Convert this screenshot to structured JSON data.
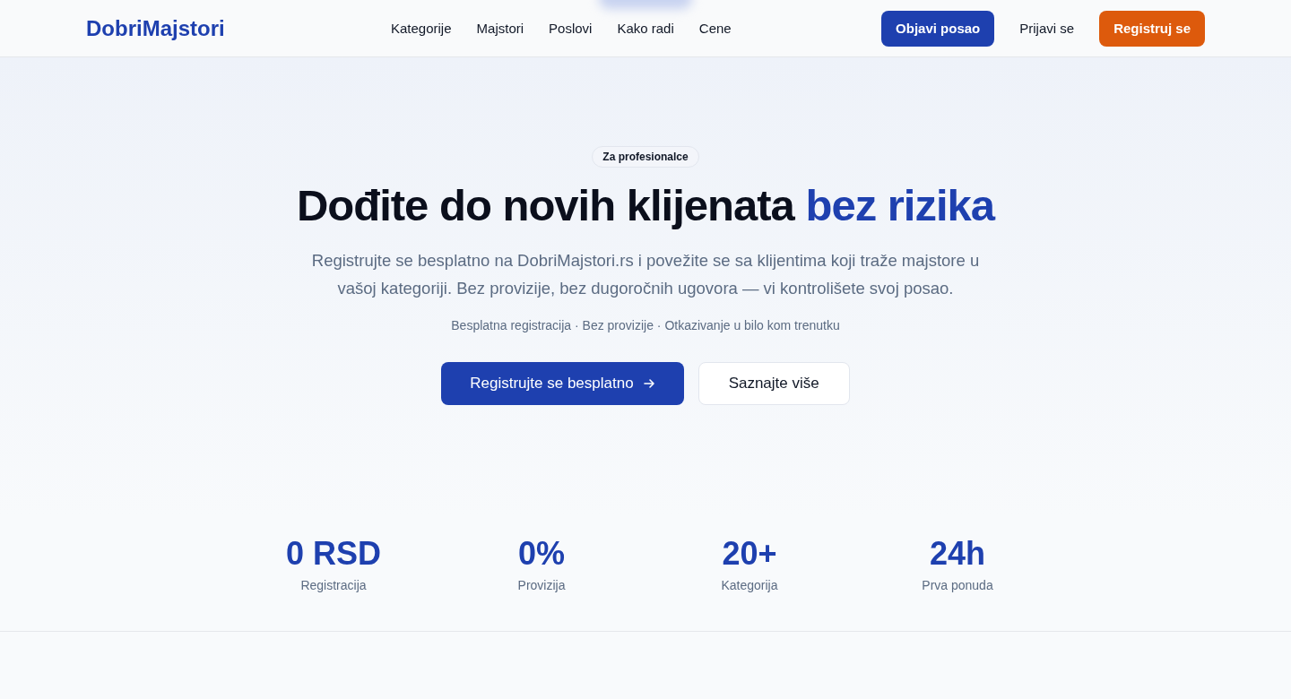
{
  "header": {
    "logo": "DobriMajstori",
    "nav": [
      {
        "label": "Kategorije"
      },
      {
        "label": "Majstori"
      },
      {
        "label": "Poslovi"
      },
      {
        "label": "Kako radi"
      },
      {
        "label": "Cene"
      }
    ],
    "actions": [
      {
        "kind": "primary",
        "label": "Objavi posao"
      },
      {
        "kind": "link",
        "label": "Prijavi se"
      },
      {
        "kind": "accent",
        "label": "Registruj se"
      }
    ]
  },
  "hero": {
    "badge": "Za profesionalce",
    "title": "Dođite do novih klijenata",
    "title_highlight": "bez rizika",
    "description": "Registrujte se besplatno na DobriMajstori.rs i povežite se sa klijentima koji traže majstore u vašoj kategoriji. Bez provizije, bez dugoročnih ugovora — vi kontrolišete svoj posao.",
    "features": "Besplatna registracija · Bez provizije · Otkazivanje u bilo kom trenutku",
    "buttons": [
      {
        "kind": "primary",
        "label": "Registrujte se besplatno"
      },
      {
        "kind": "secondary",
        "label": "Saznajte više"
      }
    ]
  },
  "stats": [
    {
      "value": "0 RSD",
      "label": "Registracija"
    },
    {
      "value": "0%",
      "label": "Provizija"
    },
    {
      "value": "20+",
      "label": "Kategorija"
    },
    {
      "value": "24h",
      "label": "Prva ponuda"
    }
  ]
}
